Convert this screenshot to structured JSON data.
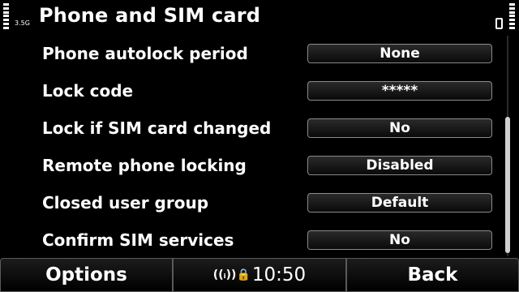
{
  "status": {
    "network_label": "3.5G",
    "title": "Phone and SIM card",
    "indicator_icons": "((ᵢ))🔒"
  },
  "settings": [
    {
      "label": "Phone autolock period",
      "value": "None"
    },
    {
      "label": "Lock code",
      "value": "*****"
    },
    {
      "label": "Lock if SIM card changed",
      "value": "No"
    },
    {
      "label": "Remote phone locking",
      "value": "Disabled"
    },
    {
      "label": "Closed user group",
      "value": "Default"
    },
    {
      "label": "Confirm SIM services",
      "value": "No"
    }
  ],
  "softkeys": {
    "left": "Options",
    "time": "10:50",
    "right": "Back"
  },
  "colors": {
    "background": "#000000",
    "text": "#ffffff",
    "border": "#8a8a8a"
  }
}
